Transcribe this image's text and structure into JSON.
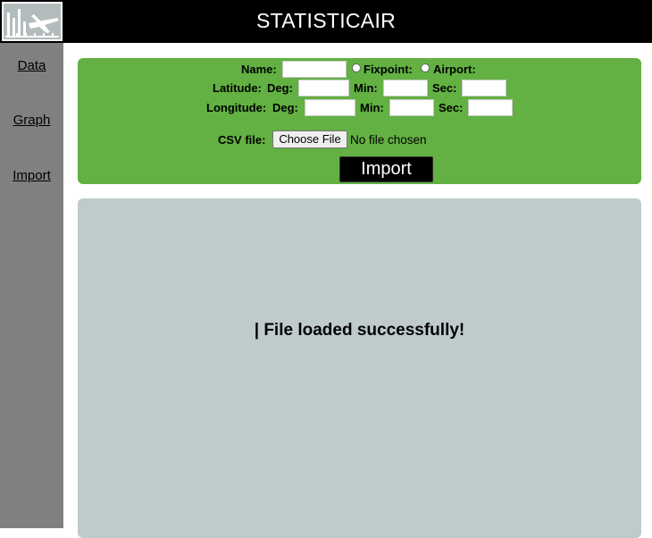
{
  "header": {
    "title": "STATISTICAIR",
    "logo_icon": "airplane-chart-logo"
  },
  "sidebar": {
    "items": [
      {
        "label": "Data"
      },
      {
        "label": "Graph"
      },
      {
        "label": "Import"
      }
    ]
  },
  "form": {
    "name_label": "Name:",
    "name_value": "",
    "fixpoint_label": "Fixpoint:",
    "airport_label": "Airport:",
    "latitude": {
      "label": "Latitude:",
      "deg_label": "Deg:",
      "min_label": "Min:",
      "sec_label": "Sec:",
      "deg_value": "",
      "min_value": "",
      "sec_value": ""
    },
    "longitude": {
      "label": "Longitude:",
      "deg_label": "Deg:",
      "min_label": "Min:",
      "sec_label": "Sec:",
      "deg_value": "",
      "min_value": "",
      "sec_value": ""
    },
    "csv_label": "CSV file:",
    "choose_file_label": "Choose File",
    "no_file_text": "No file chosen",
    "import_label": "Import"
  },
  "result": {
    "message": "| File loaded successfully!"
  },
  "colors": {
    "header_bg": "#000000",
    "sidebar_bg": "#808080",
    "form_bg": "#62b142",
    "result_bg": "#bfcbcb"
  }
}
